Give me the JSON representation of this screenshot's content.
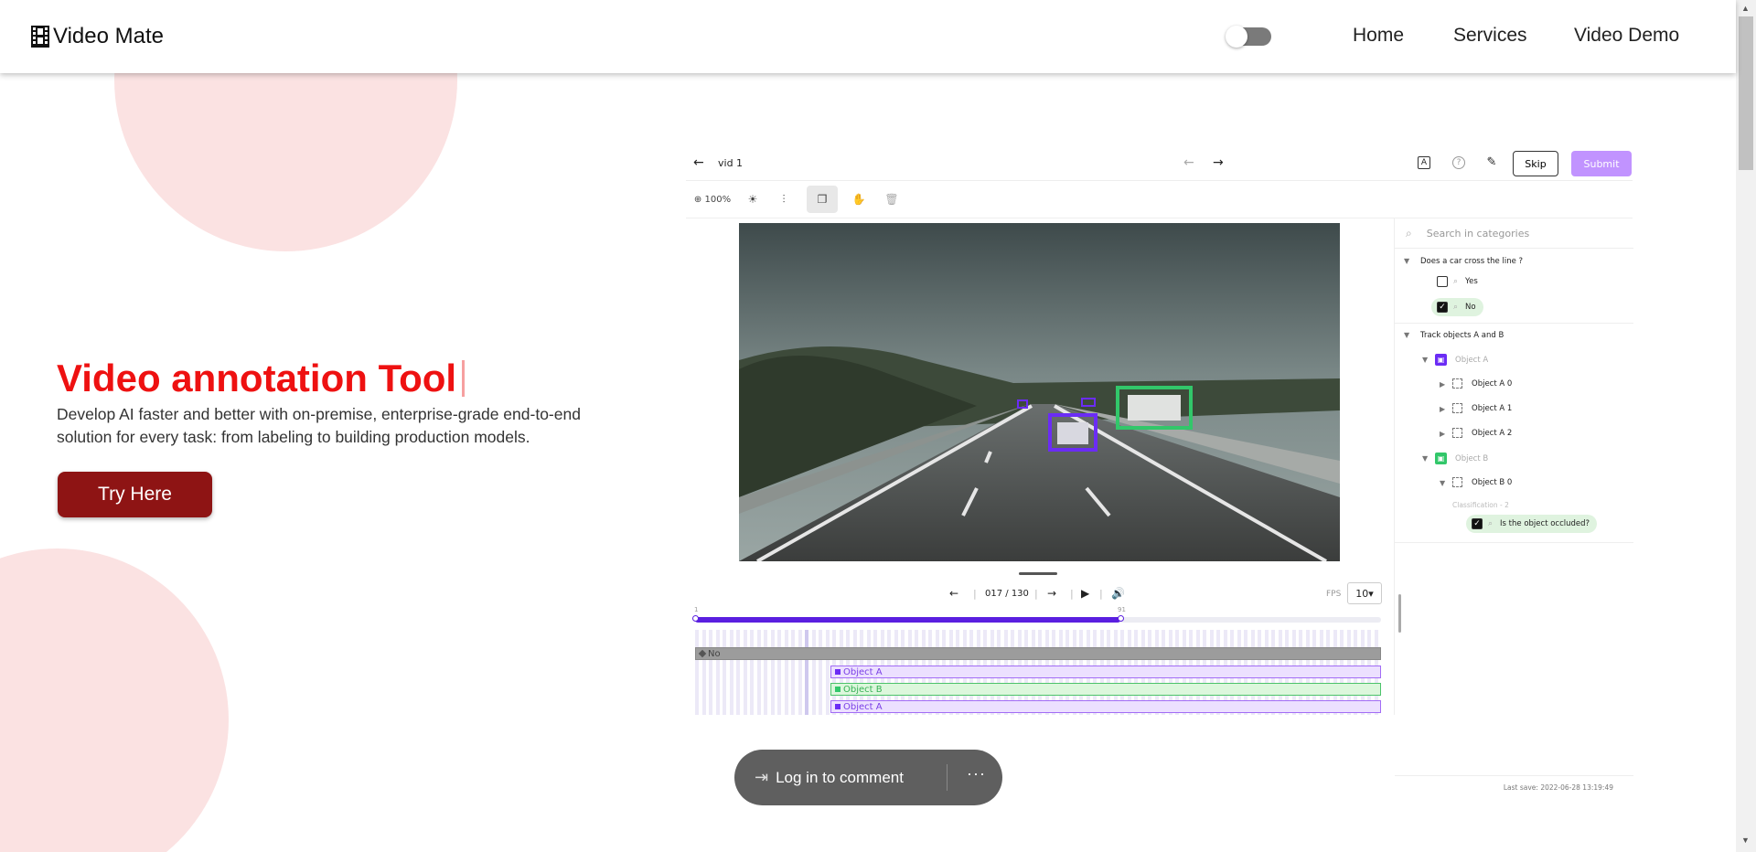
{
  "header": {
    "brand": "Video Mate",
    "nav": [
      "Home",
      "Services",
      "Video Demo"
    ]
  },
  "hero": {
    "title": "Video annotation Tool",
    "description": "Develop AI faster and better with on-premise, enterprise-grade end-to-end solution for every task: from labeling to building production models.",
    "cta": "Try Here"
  },
  "tool": {
    "video_name": "vid 1",
    "skip": "Skip",
    "submit": "Submit",
    "zoom": "100%",
    "frame_counter": "017 / 130",
    "fps_label": "FPS",
    "fps_value": "10",
    "timeline": {
      "start_tick": "1",
      "end_tick": "91",
      "progress_fraction": 0.62,
      "rows": [
        "No",
        "Object A",
        "Object B",
        "Object A"
      ]
    },
    "panel": {
      "search_placeholder": "Search in categories",
      "question1": "Does a car cross the line ?",
      "option_yes": "Yes",
      "option_no": "No",
      "question2": "Track objects A and B",
      "object_a": "Object A",
      "object_a_items": [
        "Object A 0",
        "Object A 1",
        "Object A 2"
      ],
      "object_b": "Object B",
      "object_b_items": [
        "Object B 0"
      ],
      "classification": "Classification - 2",
      "occluded": "Is the object occluded?",
      "last_save": "Last save: 2022-06-28 13:19:49"
    }
  },
  "comment": {
    "label": "Log in to comment",
    "more": "···"
  },
  "colors": {
    "accent_red": "#ee1111",
    "button_red": "#8e1414",
    "purple": "#5a1fe0",
    "green": "#4cc36a",
    "submit": "#c193ff"
  }
}
